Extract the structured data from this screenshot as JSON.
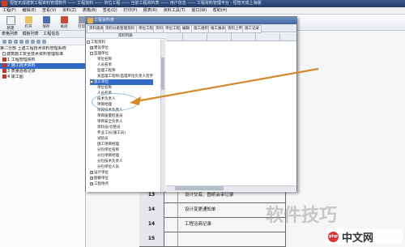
{
  "window": {
    "title": "恒智天成建筑工程资料管理软件 —— 工程资料 —— 单位工程 —— 当前工程资料表 —— 用户信息 —— 工程资料管理平台  ·  恒智天成上海版"
  },
  "menubar": [
    "工程(F)",
    "编辑(E)",
    "查看(V)",
    "资料(Z)",
    "表格(B)",
    "签名(Q)",
    "打印(P)",
    "报表(R)",
    "资料工具(T)",
    "窗口(W)",
    "帮助(H)"
  ],
  "toolbar": [
    "新建",
    "打开",
    "保存",
    "关闭",
    "打印",
    "预览",
    "导出",
    "查找"
  ],
  "left_pane": {
    "tabs": [
      "表格列表",
      "模板列表",
      "工程信息"
    ],
    "tree": [
      "第二分部 土建工程技术资料管理系统",
      "建筑施工安全技术资料管理标准",
      "1 工程管理资料",
      "2 施工技术资料",
      "3 质量验收记录",
      "4 竣工图"
    ]
  },
  "dialog": {
    "title": "工程资料表",
    "tabs": [
      "资料类表",
      "资料分类管理资料",
      "单位工程",
      "资料",
      "单位工程",
      "编辑",
      "施工组织",
      "竣工报表",
      "资料上传",
      "施工记录"
    ],
    "tree_header": "资料列表",
    "tree": [
      "工程资料",
      "建设单位",
      "监理单位",
      "单位名称",
      "人员名单",
      "监理工程师",
      "总监理工程师/监理单位负责人签字",
      "施工单位",
      "单位名称",
      "人员名单",
      "技术负责人",
      "项目经理",
      "项目技术负责人",
      "项目质量检查员",
      "项目安全负责人",
      "资料员/仓管员",
      "专业工长(施工员)",
      "试验员",
      "施工项目经理",
      "分包单位名称",
      "分包项目经理",
      "分包技术负责人",
      "分包单位人员",
      "设计单位",
      "勘察单位",
      "工程地点"
    ]
  },
  "grid_rows": [
    {
      "num": "13",
      "text": "设计交底、图纸会审记录"
    },
    {
      "num": "14",
      "text": "设计变更通知单"
    },
    {
      "num": "14",
      "text": "工程洽商记录"
    },
    {
      "num": "15",
      "text": ""
    }
  ],
  "watermark": {
    "text": "软件技巧",
    "logo": "php",
    "site": "中文网"
  },
  "colors": {
    "selection": "#3169c6",
    "arrow": "#d38a2a",
    "title_bar": "#1f3a66"
  }
}
